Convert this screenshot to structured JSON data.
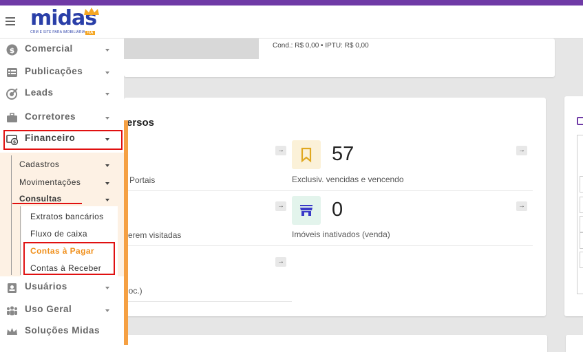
{
  "brand": {
    "logo_text": "midas",
    "logo_subtitle": "CRM E SITE PARA IMOBILIÁRIA",
    "logo_badge": "+IA",
    "accent_color": "#6f3aa6",
    "highlight_color": "#e01010",
    "orange_color": "#f5a043"
  },
  "top_card": {
    "cond_text": "Cond.: R$ 0,00 • IPTU: R$ 0,00"
  },
  "main_card": {
    "title_fragment": "ersos",
    "stats": [
      {
        "value": "57",
        "label": "Exclusiv. vencidas e vencendo",
        "icon": "bookmark-icon"
      },
      {
        "value": "0",
        "label": "Imóveis inativados (venda)",
        "icon": "store-icon"
      }
    ],
    "left_labels": [
      "Portais",
      "erem visitadas",
      "(loc.)"
    ],
    "arrow_glyph": "→"
  },
  "sidebar": {
    "items": [
      {
        "label": "Comercial",
        "icon": "dollar-icon"
      },
      {
        "label": "Publicações",
        "icon": "list-icon"
      },
      {
        "label": "Leads",
        "icon": "target-icon"
      },
      {
        "label": "Corretores",
        "icon": "briefcase-icon"
      },
      {
        "label": "Financeiro",
        "icon": "money-icon"
      },
      {
        "label": "Usuários",
        "icon": "id-card-icon"
      },
      {
        "label": "Uso Geral",
        "icon": "users-icon"
      },
      {
        "label": "Soluções Midas",
        "icon": "crown-icon"
      }
    ],
    "financeiro_sub": [
      {
        "label": "Cadastros"
      },
      {
        "label": "Movimentações"
      },
      {
        "label": "Consultas"
      }
    ],
    "consultas_sub": [
      {
        "label": "Extratos bancários"
      },
      {
        "label": "Fluxo de caixa"
      },
      {
        "label": "Contas à Pagar",
        "active": true
      },
      {
        "label": "Contas à Receber"
      }
    ]
  }
}
